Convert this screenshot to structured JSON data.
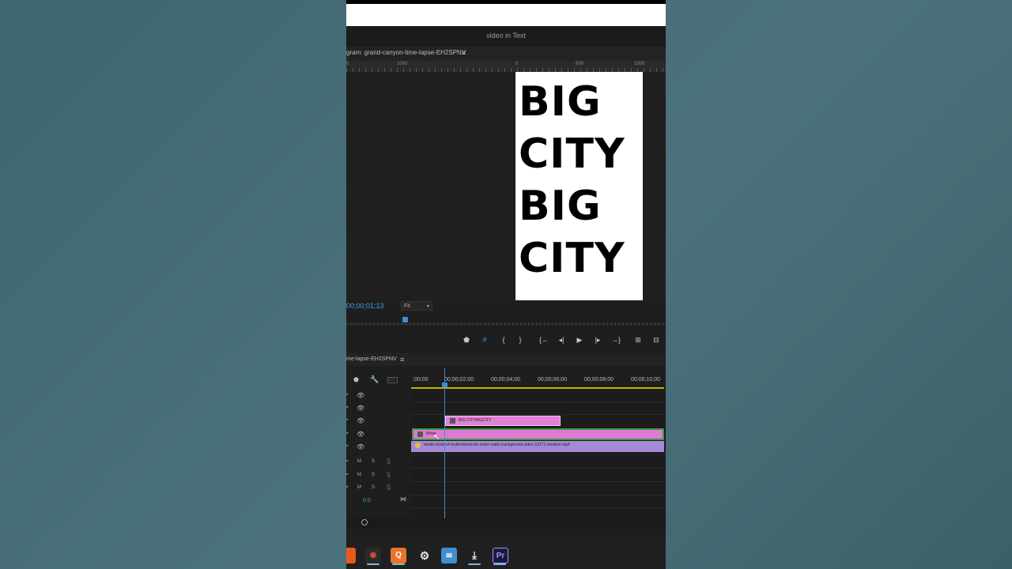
{
  "window": {
    "title": "video in Text"
  },
  "program": {
    "tab_label": "gram: grand-canyon-time-lapse-EH2SPNV",
    "menu_glyph": "≡",
    "ruler_labels": [
      "1000",
      "500",
      "0",
      "500",
      "1000"
    ],
    "timecode": "00;00;01;13",
    "fit_value": "Fit",
    "canvas_text": [
      "BIG",
      "CITY",
      "BIG",
      "CITY"
    ]
  },
  "transport": {
    "buttons": [
      "marker",
      "toggle-grid",
      "mark-in",
      "mark-out",
      "go-to-in",
      "step-back",
      "play",
      "step-forward",
      "go-to-out",
      "insert",
      "overwrite"
    ]
  },
  "timeline": {
    "tab_label": "me-lapse-EH2SPNV",
    "menu_glyph": "≡",
    "time_labels": [
      ";00;00",
      "00;00;02;00",
      "00;00;04;00",
      "00;00;06;00",
      "00;00;08;00",
      "00;00;10;00"
    ],
    "audio_track_letters": {
      "mute": "M",
      "solo": "S"
    },
    "volume_value": "0.0",
    "clips": {
      "title_clip": "BIG CITYBIGCITY",
      "white_clip": "White",
      "video_clip": "mixkit-shots-of-multicolored-ink-under-water-background-video-19171-medium.mp4"
    }
  },
  "taskbar": {
    "apps": [
      "folder",
      "chrome",
      "quickpad",
      "settings",
      "mail",
      "installer",
      "premiere"
    ],
    "premiere_label": "Pr",
    "q_label": "Q"
  },
  "colors": {
    "accent_blue": "#3a8fd6",
    "title_clip": "#e080d6",
    "white_clip": "#dd7ad4",
    "video_clip": "#a689d6",
    "yellow_bar": "#c8b400"
  }
}
